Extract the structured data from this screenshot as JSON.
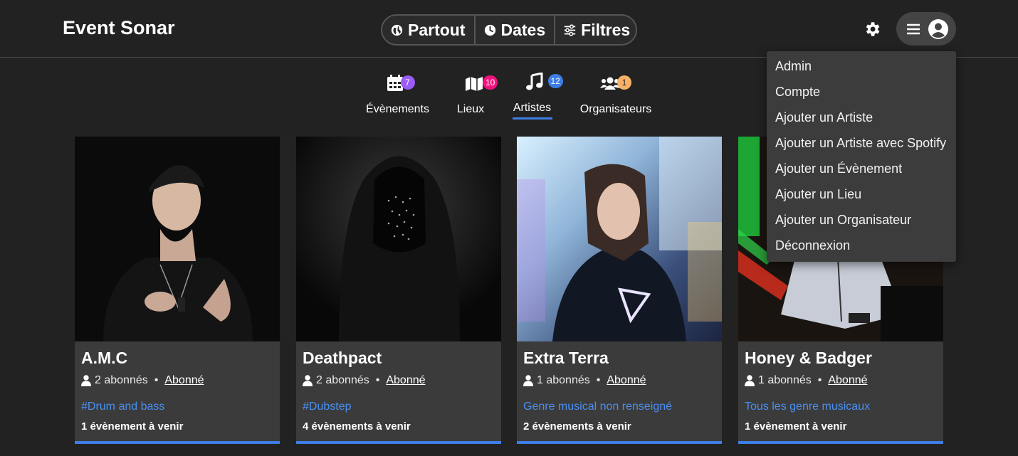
{
  "header": {
    "brand": "Event Sonar",
    "search": {
      "where": "Partout",
      "dates": "Dates",
      "filters": "Filtres"
    }
  },
  "tabs": [
    {
      "label": "Évènements",
      "count": "7",
      "badge_color": "#9b5cf5",
      "icon": "calendar-icon"
    },
    {
      "label": "Lieux",
      "count": "10",
      "badge_color": "#f0137e",
      "icon": "map-icon"
    },
    {
      "label": "Artistes",
      "count": "12",
      "badge_color": "#3d7ee6",
      "icon": "music-icon",
      "active": true
    },
    {
      "label": "Organisateurs",
      "count": "1",
      "badge_color": "#f7b267",
      "icon": "users-icon"
    }
  ],
  "artists": [
    {
      "name": "A.M.C",
      "subscribers": "2 abonnés",
      "subscribe_label": "Abonné",
      "genre": "#Drum and bass",
      "upcoming": "1 évènement à venir"
    },
    {
      "name": "Deathpact",
      "subscribers": "2 abonnés",
      "subscribe_label": "Abonné",
      "genre": "#Dubstep",
      "upcoming": "4 évènements à venir"
    },
    {
      "name": "Extra Terra",
      "subscribers": "1 abonnés",
      "subscribe_label": "Abonné",
      "genre": "Genre musical non renseigné",
      "upcoming": "2 évènements à venir"
    },
    {
      "name": "Honey & Badger",
      "subscribers": "1 abonnés",
      "subscribe_label": "Abonné",
      "genre": "Tous les genre musicaux",
      "upcoming": "1 évènement à venir"
    }
  ],
  "user_menu": {
    "items": [
      "Admin",
      "Compte",
      "Ajouter un Artiste",
      "Ajouter un Artiste avec Spotify",
      "Ajouter un Évènement",
      "Ajouter un Lieu",
      "Ajouter un Organisateur",
      "Déconnexion"
    ]
  },
  "colors": {
    "accent": "#3d7ee6",
    "genre_link": "#4a8ff0",
    "background": "#222222",
    "card": "#3b3b3b"
  }
}
